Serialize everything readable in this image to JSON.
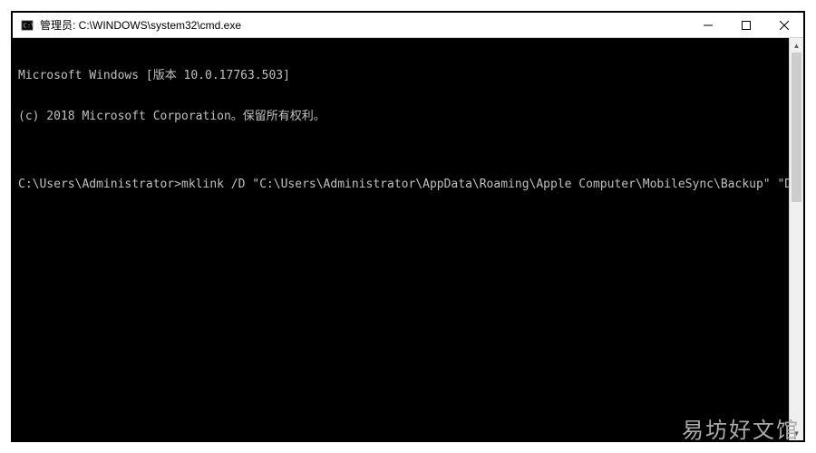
{
  "window": {
    "title": "管理员: C:\\WINDOWS\\system32\\cmd.exe"
  },
  "terminal": {
    "lines": [
      "Microsoft Windows [版本 10.0.17763.503]",
      "(c) 2018 Microsoft Corporation。保留所有权利。",
      "",
      "C:\\Users\\Administrator>mklink /D \"C:\\Users\\Administrator\\AppData\\Roaming\\Apple Computer\\MobileSync\\Backup\" \"D:\\ MobileSync\\Backup\""
    ]
  },
  "watermark": "易坊好文馆"
}
